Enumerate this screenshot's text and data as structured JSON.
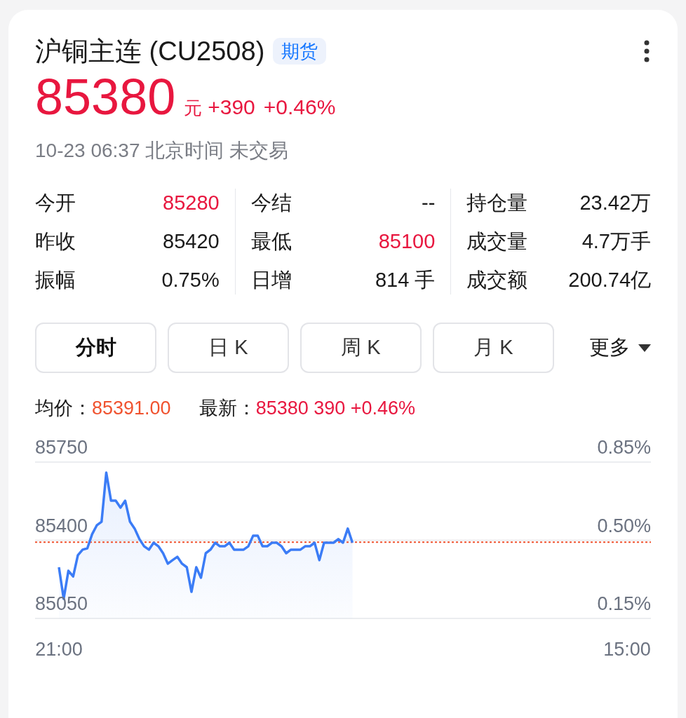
{
  "header": {
    "title": "沪铜主连 (CU2508)",
    "badge": "期货"
  },
  "quote": {
    "price": "85380",
    "unit": "元",
    "change": "+390",
    "change_pct": "+0.46%"
  },
  "status": "10-23 06:37 北京时间 未交易",
  "stats": [
    [
      {
        "label": "今开",
        "value": "85280",
        "color": "#e8173f"
      },
      {
        "label": "昨收",
        "value": "85420",
        "color": "#1a1a1a"
      },
      {
        "label": "振幅",
        "value": "0.75%",
        "color": "#1a1a1a"
      }
    ],
    [
      {
        "label": "今结",
        "value": "--",
        "color": "#1a1a1a"
      },
      {
        "label": "最低",
        "value": "85100",
        "color": "#e8173f"
      },
      {
        "label": "日增",
        "value": "814 手",
        "color": "#1a1a1a"
      }
    ],
    [
      {
        "label": "持仓量",
        "value": "23.42万",
        "color": "#1a1a1a"
      },
      {
        "label": "成交量",
        "value": "4.7万手",
        "color": "#1a1a1a"
      },
      {
        "label": "成交额",
        "value": "200.74亿",
        "color": "#1a1a1a"
      }
    ]
  ],
  "period_tabs": [
    {
      "label": "分时",
      "selected": true
    },
    {
      "label": "日 K",
      "selected": false
    },
    {
      "label": "周 K",
      "selected": false
    },
    {
      "label": "月 K",
      "selected": false
    }
  ],
  "more": "更多",
  "legend": [
    {
      "label": "均价：",
      "value": "85391.00",
      "color": "#f0522e"
    },
    {
      "label": "最新：",
      "value": "85380 390 +0.46%",
      "color": "#e8173f"
    }
  ],
  "chart": {
    "right_ticks": [
      "0.85%",
      "0.50%",
      "0.15%"
    ],
    "chart_data": {
      "type": "area",
      "categories": [
        "21:00",
        null,
        null,
        null,
        null,
        null,
        null,
        null,
        null,
        null,
        null,
        null,
        null,
        null,
        null,
        null,
        null,
        null,
        null,
        null,
        null,
        null,
        null,
        null,
        null,
        null,
        null,
        null,
        null,
        null,
        null,
        null,
        null,
        null,
        null,
        null,
        null,
        null,
        null,
        null,
        null,
        null,
        null,
        null,
        null,
        null,
        null,
        null,
        null,
        null,
        null,
        null,
        null,
        null,
        null,
        null,
        null,
        null,
        null,
        null,
        null,
        null,
        null,
        null,
        null,
        null,
        null,
        null,
        null,
        null,
        null,
        null,
        null,
        null,
        null,
        null,
        null,
        null,
        null,
        null,
        null,
        null,
        null,
        null,
        null,
        null,
        null,
        null,
        null,
        null,
        null,
        null,
        null,
        null,
        null,
        null,
        null,
        null,
        null,
        null,
        null,
        null,
        null,
        null,
        null,
        null,
        null,
        null,
        null,
        null,
        null,
        null,
        null,
        null,
        null,
        null,
        null,
        null,
        null,
        null,
        "15:00"
      ],
      "series": [
        {
          "color": "#3b7cf6",
          "values": [
            85279,
            85138,
            85263,
            85238,
            85333,
            85358,
            85364,
            85427,
            85467,
            85483,
            85703,
            85577,
            85577,
            85546,
            85577,
            85483,
            85452,
            85405,
            85373,
            85358,
            85389,
            85373,
            85342,
            85295,
            85311,
            85326,
            85295,
            85279,
            85169,
            85279,
            85232,
            85342,
            85358,
            85389,
            85373,
            85373,
            85389,
            85358,
            85358,
            85358,
            85373,
            85420,
            85420,
            85373,
            85373,
            85389,
            85389,
            85373,
            85342,
            85358,
            85358,
            85358,
            85373,
            85373,
            85389,
            85311,
            85389,
            85389,
            85389,
            85405,
            85389,
            85452,
            85389,
            null,
            null,
            null,
            null,
            null,
            null,
            null,
            null,
            null,
            null,
            null,
            null,
            null,
            null,
            null,
            null,
            null,
            null,
            null,
            null,
            null,
            null,
            null,
            null,
            null,
            null,
            null,
            null,
            null,
            null,
            null,
            null,
            null,
            null,
            null,
            null,
            null,
            null,
            null,
            null,
            null,
            null,
            null,
            null,
            null,
            null,
            null,
            null,
            null,
            null,
            null,
            null,
            null,
            null,
            null,
            null,
            null,
            null
          ]
        }
      ],
      "ylim": [
        85050,
        85750
      ],
      "yticks": [
        85750,
        85400,
        85050
      ],
      "ref_lines": [
        {
          "axis": "y",
          "value": 85391
        }
      ]
    }
  }
}
